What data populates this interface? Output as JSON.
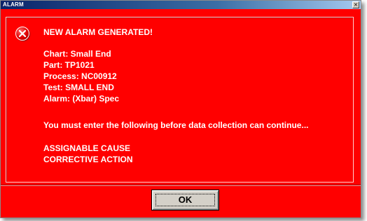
{
  "window": {
    "title": "ALARM",
    "close_glyph": "×"
  },
  "message": {
    "heading": "NEW ALARM GENERATED!",
    "chart": "Chart: Small End",
    "part": "Part: TP1021",
    "process": "Process: NC00912",
    "test": "Test: SMALL END",
    "alarm": "Alarm: (Xbar) Spec",
    "instruction": "You must enter the following before data collection can continue...",
    "required_1": "ASSIGNABLE CAUSE",
    "required_2": "CORRECTIVE ACTION"
  },
  "buttons": {
    "ok_label": "OK"
  },
  "icons": {
    "error": "error-x-icon",
    "close": "close-icon"
  },
  "colors": {
    "background": "#ff0000",
    "text": "#ffffff",
    "button_face": "#d4d0c8",
    "titlebar_start": "#0a246a",
    "titlebar_end": "#a6caf0"
  }
}
